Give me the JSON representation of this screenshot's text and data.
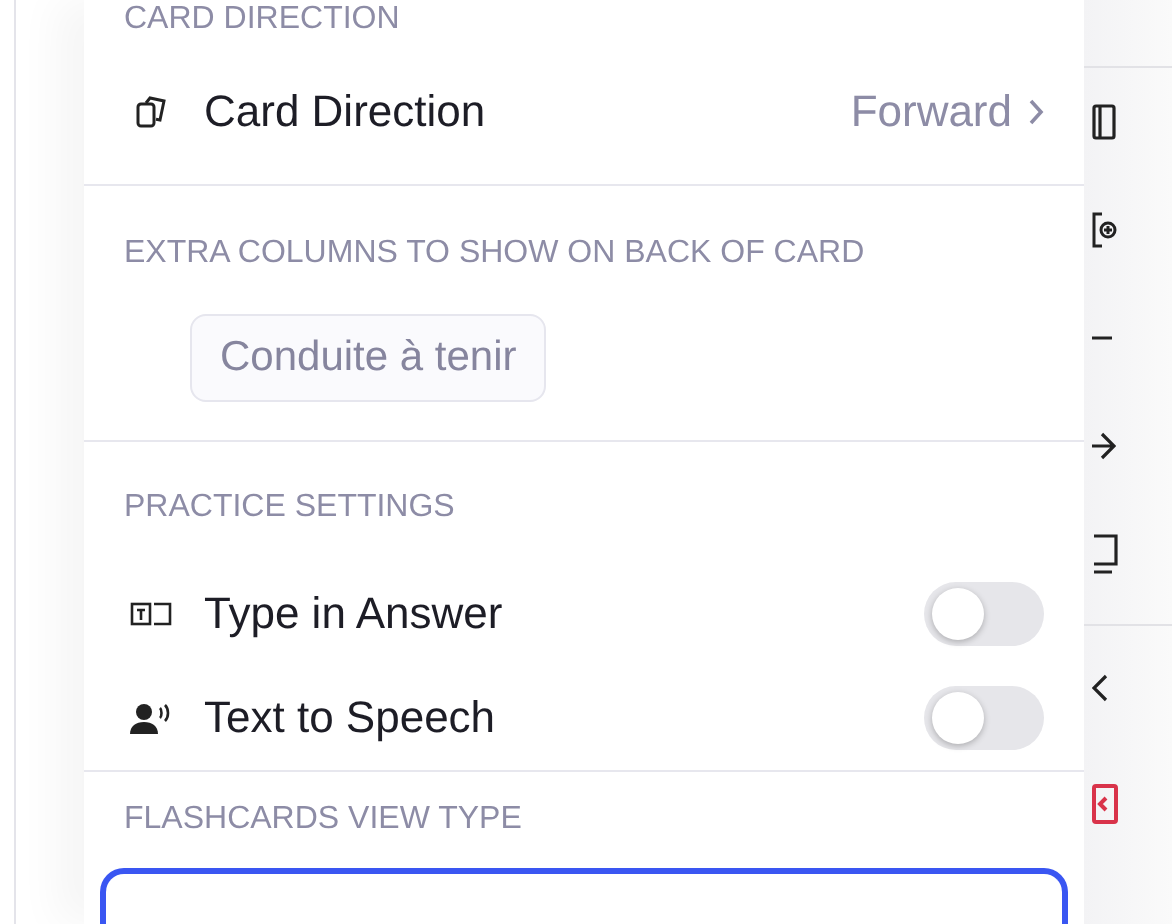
{
  "panel": {
    "sections": [
      {
        "heading": "CARD DIRECTION",
        "kind": "direction",
        "rows": [
          {
            "label": "Card Direction",
            "value": "Forward"
          }
        ]
      },
      {
        "heading": "EXTRA COLUMNS TO SHOW ON BACK OF CARD",
        "kind": "chips",
        "chips": [
          {
            "label": "Conduite à tenir",
            "selected": false
          }
        ]
      },
      {
        "heading": "PRACTICE SETTINGS",
        "kind": "toggles",
        "rows": [
          {
            "label": "Type in Answer",
            "on": false
          },
          {
            "label": "Text to Speech",
            "on": false
          }
        ]
      },
      {
        "heading": "FLASHCARDS VIEW TYPE",
        "kind": "select"
      }
    ]
  }
}
